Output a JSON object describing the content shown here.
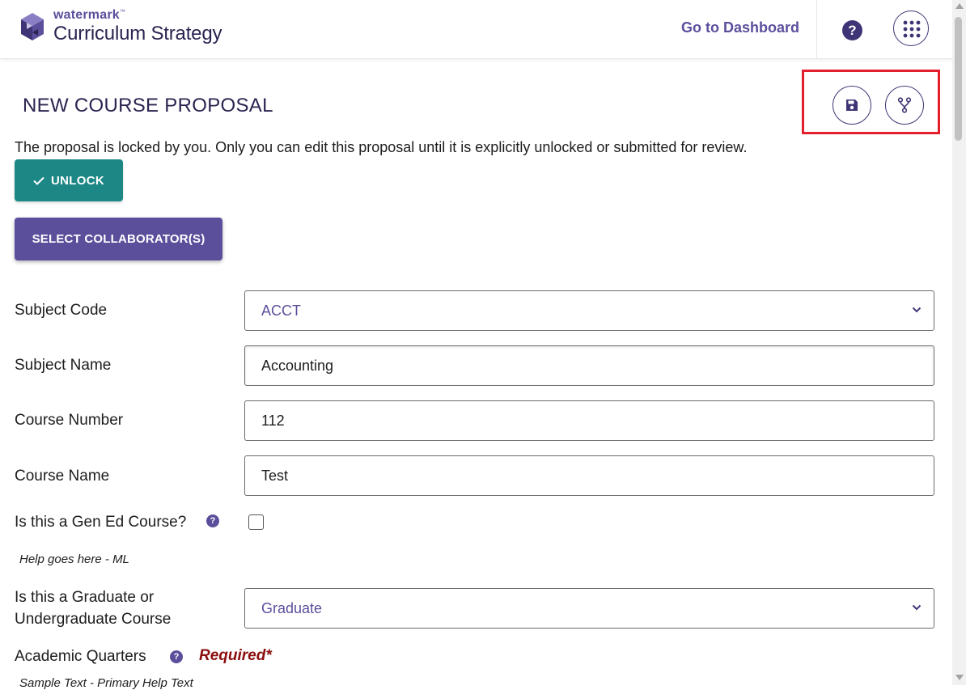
{
  "header": {
    "brand_small": "watermark",
    "brand_tm": "™",
    "brand_product": "Curriculum Strategy",
    "dashboard_link": "Go to Dashboard",
    "help_glyph": "?",
    "icons": {
      "logo": "watermark-logo-icon",
      "help": "help-icon",
      "apps": "app-grid-icon"
    }
  },
  "page": {
    "title": "NEW COURSE PROPOSAL",
    "actions": {
      "save_icon": "save-icon",
      "branch_icon": "branch-icon",
      "highlight_color": "#e31e2d"
    },
    "lock_message": "The proposal is locked by you. Only you can edit this proposal until it is explicitly unlocked or submitted for review.",
    "unlock_button": "UNLOCK",
    "collaborators_button": "SELECT COLLABORATOR(S)"
  },
  "form": {
    "subject_code": {
      "label": "Subject Code",
      "value": "ACCT"
    },
    "subject_name": {
      "label": "Subject Name",
      "value": "Accounting"
    },
    "course_number": {
      "label": "Course Number",
      "value": "112"
    },
    "course_name": {
      "label": "Course Name",
      "value": "Test"
    },
    "gen_ed": {
      "label": "Is this a Gen Ed Course?",
      "checked": false,
      "help_text": "Help goes here - ML"
    },
    "level": {
      "label_line1": "Is this a Graduate or",
      "label_line2": "Undergraduate Course",
      "value": "Graduate"
    },
    "academic_quarters": {
      "label": "Academic Quarters",
      "required": "Required*",
      "help_text": "Sample Text - Primary Help Text"
    }
  },
  "colors": {
    "brand_purple": "#5b4f9c",
    "dark_purple": "#3f3576",
    "teal": "#1c8785",
    "required_red": "#8b0e0e"
  }
}
